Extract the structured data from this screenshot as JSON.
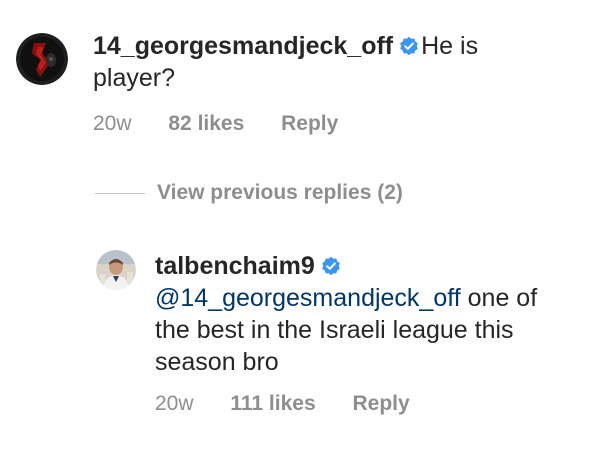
{
  "comment": {
    "username": "14_georgesmandjeck_off",
    "text_line1": "He is",
    "text_line2": "player?",
    "time": "20w",
    "likes": "82 likes",
    "reply": "Reply",
    "verified_icon": "verified-badge-icon"
  },
  "view_previous": {
    "label": "View previous replies (2)"
  },
  "reply_comment": {
    "username": "talbenchaim9",
    "mention": "@14_georgesmandjeck_off",
    "text_line1": " one of",
    "text_line2": "the best in the Israeli league this",
    "text_line3": "season bro",
    "time": "20w",
    "likes": "111 likes",
    "reply": "Reply",
    "verified_icon": "verified-badge-icon"
  },
  "colors": {
    "verified": "#3897f0",
    "meta_text": "#8e8e8e",
    "mention": "#00376b"
  }
}
